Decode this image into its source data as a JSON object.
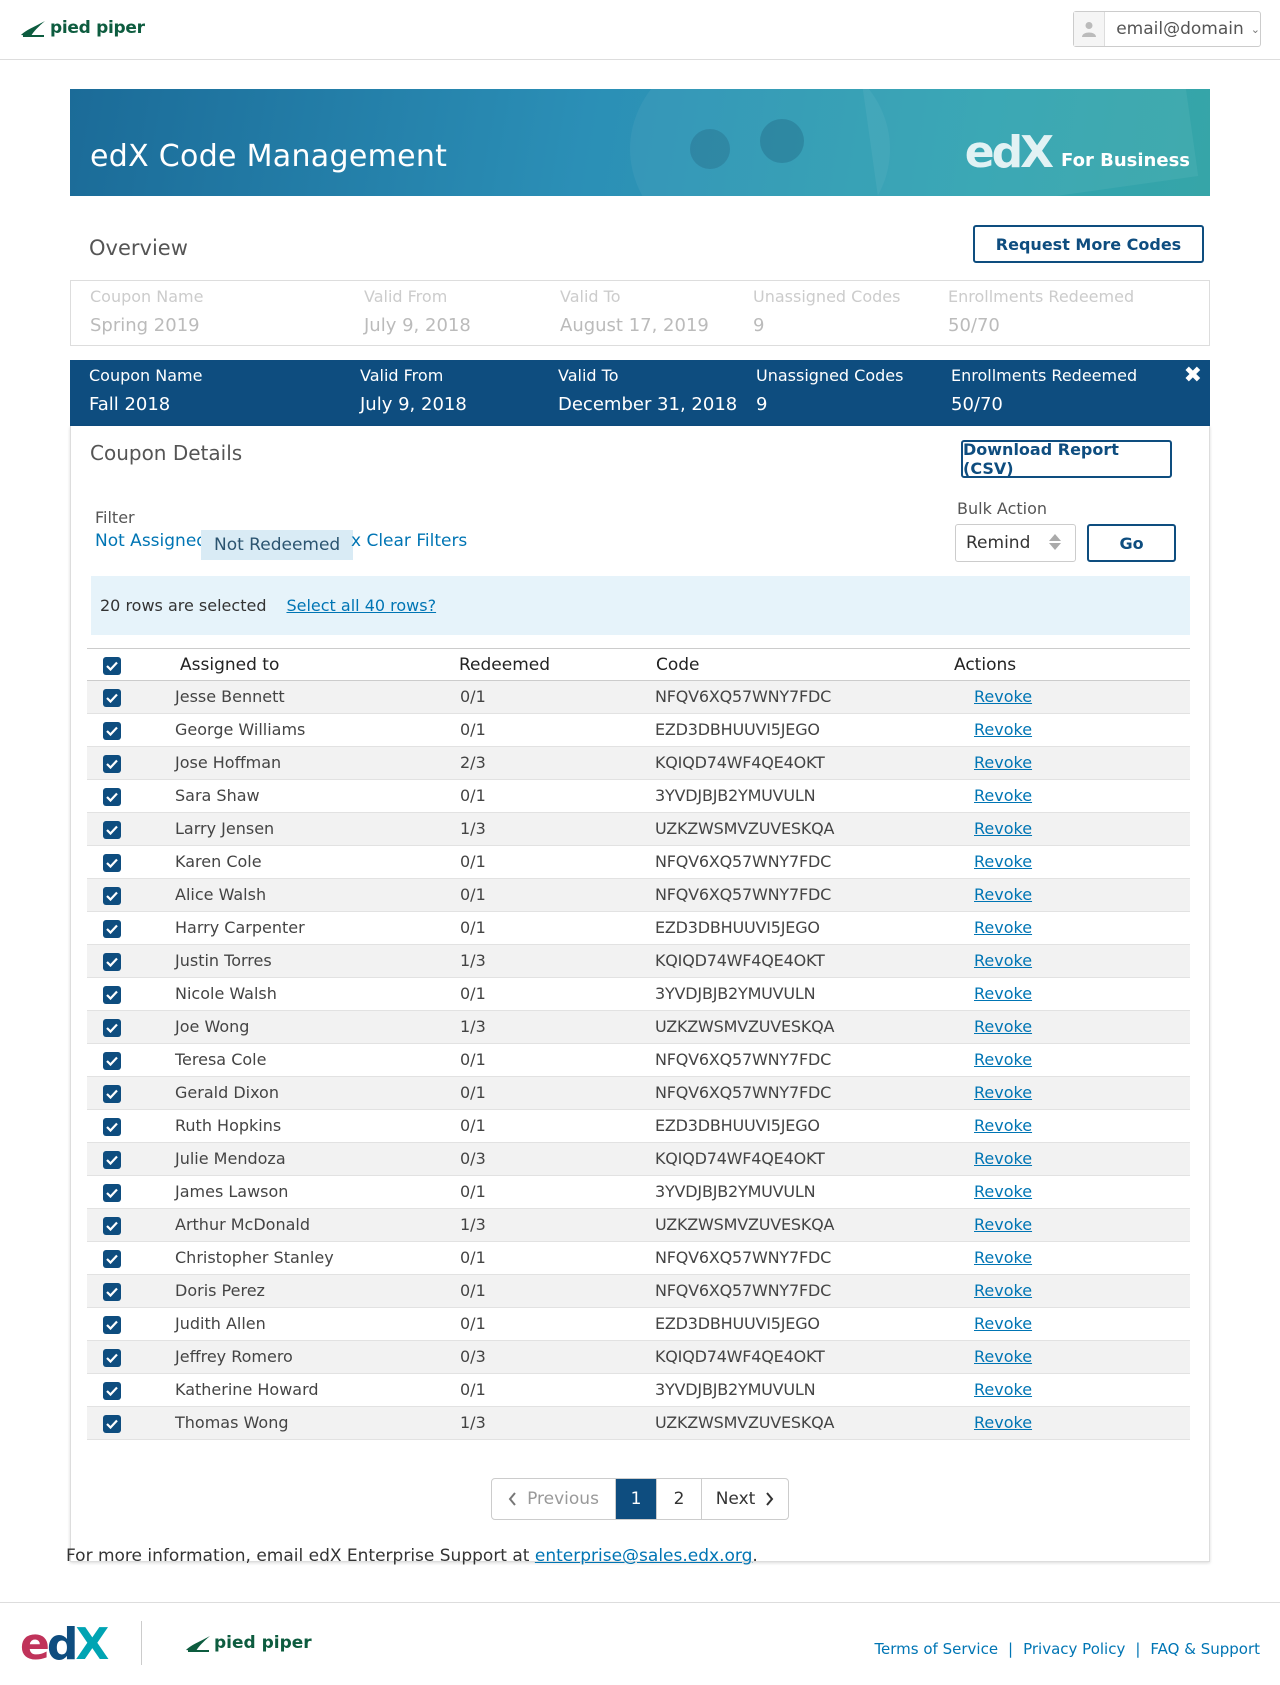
{
  "header": {
    "brand": "pied piper",
    "user_email": "email@domain"
  },
  "hero": {
    "title": "edX Code Management",
    "brand_mark": "edX",
    "brand_suffix": "For Business"
  },
  "overview": {
    "title": "Overview",
    "request_button": "Request More Codes",
    "labels": {
      "coupon_name": "Coupon Name",
      "valid_from": "Valid From",
      "valid_to": "Valid To",
      "unassigned": "Unassigned Codes",
      "enrollments": "Enrollments Redeemed"
    },
    "coupons": [
      {
        "name": "Spring 2019",
        "valid_from": "July 9, 2018",
        "valid_to": "August 17, 2019",
        "unassigned": "9",
        "enrollments": "50/70"
      },
      {
        "name": "Fall 2018",
        "valid_from": "July 9, 2018",
        "valid_to": "December 31, 2018",
        "unassigned": "9",
        "enrollments": "50/70"
      }
    ]
  },
  "details": {
    "title": "Coupon Details",
    "download_button": "Download Report (CSV)",
    "filter_label": "Filter",
    "filters": [
      "Not Assigned",
      "Not Redeemed",
      "x Clear Filters"
    ],
    "bulk_label": "Bulk Action",
    "bulk_value": "Remind",
    "go_button": "Go",
    "selection_text": "20 rows are selected",
    "select_all_link": "Select all 40 rows?",
    "columns": [
      "Assigned to",
      "Redeemed",
      "Code",
      "Actions"
    ],
    "rows": [
      {
        "name": "Jesse Bennett",
        "redeemed": "0/1",
        "code": "NFQV6XQ57WNY7FDC",
        "action": "Revoke"
      },
      {
        "name": "George Williams",
        "redeemed": "0/1",
        "code": "EZD3DBHUUVI5JEGO",
        "action": "Revoke"
      },
      {
        "name": "Jose Hoffman",
        "redeemed": "2/3",
        "code": "KQIQD74WF4QE4OKT",
        "action": "Revoke"
      },
      {
        "name": "Sara Shaw",
        "redeemed": "0/1",
        "code": "3YVDJBJB2YMUVULN",
        "action": "Revoke"
      },
      {
        "name": "Larry Jensen",
        "redeemed": "1/3",
        "code": "UZKZWSMVZUVESKQA",
        "action": "Revoke"
      },
      {
        "name": "Karen Cole",
        "redeemed": "0/1",
        "code": "NFQV6XQ57WNY7FDC",
        "action": "Revoke"
      },
      {
        "name": "Alice Walsh",
        "redeemed": "0/1",
        "code": "NFQV6XQ57WNY7FDC",
        "action": "Revoke"
      },
      {
        "name": "Harry Carpenter",
        "redeemed": "0/1",
        "code": "EZD3DBHUUVI5JEGO",
        "action": "Revoke"
      },
      {
        "name": "Justin Torres",
        "redeemed": "1/3",
        "code": "KQIQD74WF4QE4OKT",
        "action": "Revoke"
      },
      {
        "name": "Nicole Walsh",
        "redeemed": "0/1",
        "code": "3YVDJBJB2YMUVULN",
        "action": "Revoke"
      },
      {
        "name": "Joe Wong",
        "redeemed": "1/3",
        "code": "UZKZWSMVZUVESKQA",
        "action": "Revoke"
      },
      {
        "name": "Teresa Cole",
        "redeemed": "0/1",
        "code": "NFQV6XQ57WNY7FDC",
        "action": "Revoke"
      },
      {
        "name": "Gerald Dixon",
        "redeemed": "0/1",
        "code": "NFQV6XQ57WNY7FDC",
        "action": "Revoke"
      },
      {
        "name": "Ruth Hopkins",
        "redeemed": "0/1",
        "code": "EZD3DBHUUVI5JEGO",
        "action": "Revoke"
      },
      {
        "name": "Julie Mendoza",
        "redeemed": "0/3",
        "code": "KQIQD74WF4QE4OKT",
        "action": "Revoke"
      },
      {
        "name": "James Lawson",
        "redeemed": "0/1",
        "code": "3YVDJBJB2YMUVULN",
        "action": "Revoke"
      },
      {
        "name": "Arthur McDonald",
        "redeemed": "1/3",
        "code": "UZKZWSMVZUVESKQA",
        "action": "Revoke"
      },
      {
        "name": "Christopher Stanley",
        "redeemed": "0/1",
        "code": "NFQV6XQ57WNY7FDC",
        "action": "Revoke"
      },
      {
        "name": "Doris Perez",
        "redeemed": "0/1",
        "code": "NFQV6XQ57WNY7FDC",
        "action": "Revoke"
      },
      {
        "name": "Judith Allen",
        "redeemed": "0/1",
        "code": "EZD3DBHUUVI5JEGO",
        "action": "Revoke"
      },
      {
        "name": "Jeffrey Romero",
        "redeemed": "0/3",
        "code": "KQIQD74WF4QE4OKT",
        "action": "Revoke"
      },
      {
        "name": "Katherine Howard",
        "redeemed": "0/1",
        "code": "3YVDJBJB2YMUVULN",
        "action": "Revoke"
      },
      {
        "name": "Thomas Wong",
        "redeemed": "1/3",
        "code": "UZKZWSMVZUVESKQA",
        "action": "Revoke"
      }
    ],
    "pagination": {
      "previous": "Previous",
      "pages": [
        "1",
        "2"
      ],
      "current": "1",
      "next": "Next"
    }
  },
  "info": {
    "text": "For more information, email edX Enterprise Support at ",
    "email": "enterprise@sales.edx.org",
    "suffix": "."
  },
  "footer": {
    "links": [
      "Terms of Service",
      "Privacy Policy",
      "FAQ & Support"
    ],
    "separator": "|"
  },
  "icons": {
    "logo": "pied-piper-logo",
    "user": "user-icon",
    "checkbox": "checkbox-checked-icon"
  },
  "colors": {
    "primary": "#0e4d7f",
    "link": "#0075b4",
    "banner_bg": "#e6f3fa",
    "filter_active_bg": "#d9ebf5"
  }
}
